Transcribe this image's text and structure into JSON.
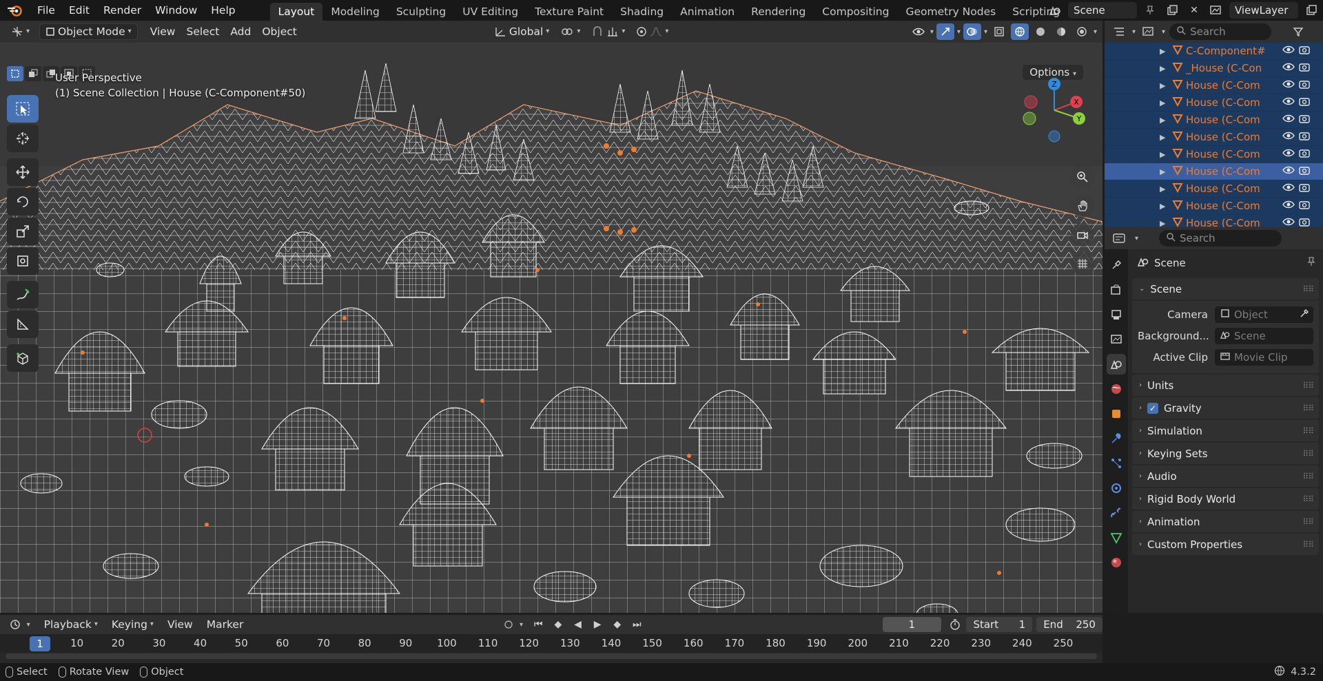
{
  "app": {
    "icon": "blender-logo-icon"
  },
  "menu": [
    "File",
    "Edit",
    "Render",
    "Window",
    "Help"
  ],
  "workspaces": {
    "tabs": [
      "Layout",
      "Modeling",
      "Sculpting",
      "UV Editing",
      "Texture Paint",
      "Shading",
      "Animation",
      "Rendering",
      "Compositing",
      "Geometry Nodes",
      "Scripting"
    ],
    "active": "Layout",
    "add_icon": "plus-icon"
  },
  "top_right": {
    "scene": "Scene",
    "view_layer": "ViewLayer"
  },
  "viewport": {
    "mode": "Object Mode",
    "menus": [
      "View",
      "Select",
      "Add",
      "Object"
    ],
    "transform_orientation": "Global",
    "perspective_label": "User Perspective",
    "collection_label": "(1) Scene Collection | House (C-Component#50)",
    "options_label": "Options",
    "gizmo_axes": {
      "x": "X",
      "y": "Y",
      "z": "Z"
    },
    "colors": {
      "background": "#393939",
      "wire": "#ffffff",
      "selected_wire": "#f07b2c",
      "grid": "#4a4a4a"
    }
  },
  "outliner": {
    "search_placeholder": "Search",
    "rows": [
      {
        "name": "C-Component#",
        "selected": false
      },
      {
        "name": "_House (C-Con",
        "selected": false
      },
      {
        "name": "House (C-Com",
        "selected": false
      },
      {
        "name": "House (C-Com",
        "selected": false
      },
      {
        "name": "House (C-Com",
        "selected": false
      },
      {
        "name": "House (C-Com",
        "selected": false
      },
      {
        "name": "House (C-Com",
        "selected": false
      },
      {
        "name": "House (C-Com",
        "selected": true
      },
      {
        "name": "House (C-Com",
        "selected": false
      },
      {
        "name": "House (C-Com",
        "selected": false
      },
      {
        "name": "House (C-Com",
        "selected": false
      }
    ]
  },
  "properties": {
    "search_placeholder": "Search",
    "context": "Scene",
    "scene_panel": {
      "title": "Scene",
      "camera_label": "Camera",
      "camera_placeholder": "Object",
      "background_label": "Background...",
      "background_placeholder": "Scene",
      "clip_label": "Active Clip",
      "clip_placeholder": "Movie Clip"
    },
    "panels": [
      "Units",
      "Gravity",
      "Simulation",
      "Keying Sets",
      "Audio",
      "Rigid Body World",
      "Animation",
      "Custom Properties"
    ],
    "gravity_checked": true
  },
  "timeline": {
    "menus": [
      "Playback",
      "Keying",
      "View",
      "Marker"
    ],
    "current_frame": "1",
    "start_label": "Start",
    "start": "1",
    "end_label": "End",
    "end": "250",
    "ticks": [
      "10",
      "20",
      "30",
      "40",
      "50",
      "60",
      "70",
      "80",
      "90",
      "100",
      "110",
      "120",
      "130",
      "140",
      "150",
      "160",
      "170",
      "180",
      "190",
      "200",
      "210",
      "220",
      "230",
      "240",
      "250"
    ]
  },
  "statusbar": {
    "items": [
      "Select",
      "Rotate View",
      "Object"
    ],
    "version": "4.3.2"
  }
}
